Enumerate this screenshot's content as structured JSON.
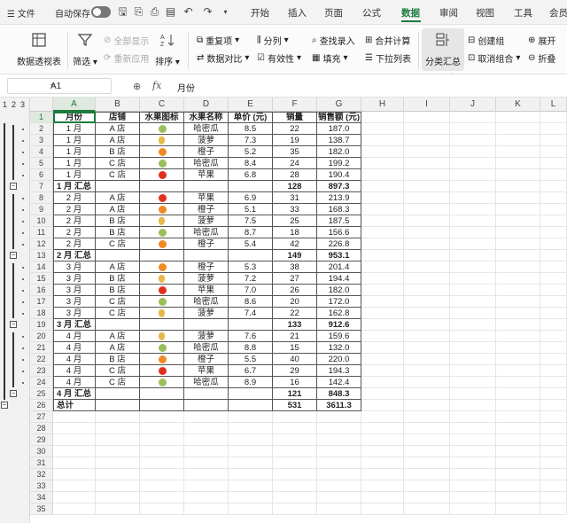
{
  "titlebar": {
    "menu": "文件",
    "autosave": "自动保存",
    "tabs": [
      "开始",
      "插入",
      "页面",
      "公式",
      "数据",
      "审阅",
      "视图",
      "工具",
      "会员"
    ],
    "active_tab": "数据"
  },
  "ribbon": {
    "pivot": "数据透视表",
    "filter": "筛选",
    "show_all": "全部显示",
    "reapply": "重新应用",
    "sort": "排序",
    "duplicates": "重复项",
    "compare": "数据对比",
    "split": "分列",
    "validity": "有效性",
    "lookup": "查找录入",
    "fill": "填充",
    "merge_calc": "合并计算",
    "dropdown": "下拉列表",
    "subtotal": "分类汇总",
    "create_group": "创建组",
    "ungroup": "取消组合",
    "expand": "展开",
    "collapse": "折叠"
  },
  "formula_bar": {
    "cell_ref": "A1",
    "fx": "fx",
    "value": "月份"
  },
  "outline_levels": [
    "1",
    "2",
    "3"
  ],
  "columns": [
    "A",
    "B",
    "C",
    "D",
    "E",
    "F",
    "G",
    "H",
    "I",
    "J",
    "K",
    "L"
  ],
  "row_numbers": [
    "1",
    "2",
    "3",
    "4",
    "5",
    "6",
    "7",
    "8",
    "9",
    "10",
    "11",
    "12",
    "13",
    "14",
    "15",
    "16",
    "17",
    "18",
    "19",
    "20",
    "21",
    "22",
    "23",
    "24",
    "25",
    "26",
    "27",
    "28",
    "29",
    "30",
    "31",
    "32",
    "33",
    "34",
    "35"
  ],
  "headers": [
    "月份",
    "店铺",
    "水果图标",
    "水果名称",
    "单价 (元)",
    "销量",
    "销售额 (元)"
  ],
  "rows": [
    {
      "m": "1 月",
      "s": "A 店",
      "fruit": "pear",
      "name": "哈密瓜",
      "price": "8.5",
      "qty": "22",
      "amt": "187.0"
    },
    {
      "m": "1 月",
      "s": "A 店",
      "fruit": "pineapple",
      "name": "菠萝",
      "price": "7.3",
      "qty": "19",
      "amt": "138.7"
    },
    {
      "m": "1 月",
      "s": "B 店",
      "fruit": "orange",
      "name": "橙子",
      "price": "5.2",
      "qty": "35",
      "amt": "182.0"
    },
    {
      "m": "1 月",
      "s": "C 店",
      "fruit": "pear",
      "name": "哈密瓜",
      "price": "8.4",
      "qty": "24",
      "amt": "199.2"
    },
    {
      "m": "1 月",
      "s": "C 店",
      "fruit": "apple",
      "name": "苹果",
      "price": "6.8",
      "qty": "28",
      "amt": "190.4"
    },
    {
      "sub": true,
      "m": "1 月 汇总",
      "qty": "128",
      "amt": "897.3"
    },
    {
      "m": "2 月",
      "s": "A 店",
      "fruit": "apple",
      "name": "苹果",
      "price": "6.9",
      "qty": "31",
      "amt": "213.9"
    },
    {
      "m": "2 月",
      "s": "A 店",
      "fruit": "orange",
      "name": "橙子",
      "price": "5.1",
      "qty": "33",
      "amt": "168.3"
    },
    {
      "m": "2 月",
      "s": "B 店",
      "fruit": "pineapple",
      "name": "菠萝",
      "price": "7.5",
      "qty": "25",
      "amt": "187.5"
    },
    {
      "m": "2 月",
      "s": "B 店",
      "fruit": "pear",
      "name": "哈密瓜",
      "price": "8.7",
      "qty": "18",
      "amt": "156.6"
    },
    {
      "m": "2 月",
      "s": "C 店",
      "fruit": "orange",
      "name": "橙子",
      "price": "5.4",
      "qty": "42",
      "amt": "226.8"
    },
    {
      "sub": true,
      "m": "2 月 汇总",
      "qty": "149",
      "amt": "953.1"
    },
    {
      "m": "3 月",
      "s": "A 店",
      "fruit": "orange",
      "name": "橙子",
      "price": "5.3",
      "qty": "38",
      "amt": "201.4"
    },
    {
      "m": "3 月",
      "s": "B 店",
      "fruit": "pineapple",
      "name": "菠萝",
      "price": "7.2",
      "qty": "27",
      "amt": "194.4"
    },
    {
      "m": "3 月",
      "s": "B 店",
      "fruit": "apple",
      "name": "苹果",
      "price": "7.0",
      "qty": "26",
      "amt": "182.0"
    },
    {
      "m": "3 月",
      "s": "C 店",
      "fruit": "pear",
      "name": "哈密瓜",
      "price": "8.6",
      "qty": "20",
      "amt": "172.0"
    },
    {
      "m": "3 月",
      "s": "C 店",
      "fruit": "pineapple",
      "name": "菠萝",
      "price": "7.4",
      "qty": "22",
      "amt": "162.8"
    },
    {
      "sub": true,
      "m": "3 月 汇总",
      "qty": "133",
      "amt": "912.6"
    },
    {
      "m": "4 月",
      "s": "A 店",
      "fruit": "pineapple",
      "name": "菠萝",
      "price": "7.6",
      "qty": "21",
      "amt": "159.6"
    },
    {
      "m": "4 月",
      "s": "A 店",
      "fruit": "pear",
      "name": "哈密瓜",
      "price": "8.8",
      "qty": "15",
      "amt": "132.0"
    },
    {
      "m": "4 月",
      "s": "B 店",
      "fruit": "orange",
      "name": "橙子",
      "price": "5.5",
      "qty": "40",
      "amt": "220.0"
    },
    {
      "m": "4 月",
      "s": "C 店",
      "fruit": "apple",
      "name": "苹果",
      "price": "6.7",
      "qty": "29",
      "amt": "194.3"
    },
    {
      "m": "4 月",
      "s": "C 店",
      "fruit": "pear",
      "name": "哈密瓜",
      "price": "8.9",
      "qty": "16",
      "amt": "142.4"
    },
    {
      "sub": true,
      "m": "4 月 汇总",
      "qty": "121",
      "amt": "848.3"
    },
    {
      "sub": true,
      "m": "总计",
      "qty": "531",
      "amt": "3611.3"
    }
  ],
  "fruit_colors": {
    "pear": "#9bbf5a",
    "pineapple": "#e9b84a",
    "orange": "#f08a24",
    "apple": "#e0301e"
  },
  "colors": {
    "accent": "#1e7b3e"
  }
}
